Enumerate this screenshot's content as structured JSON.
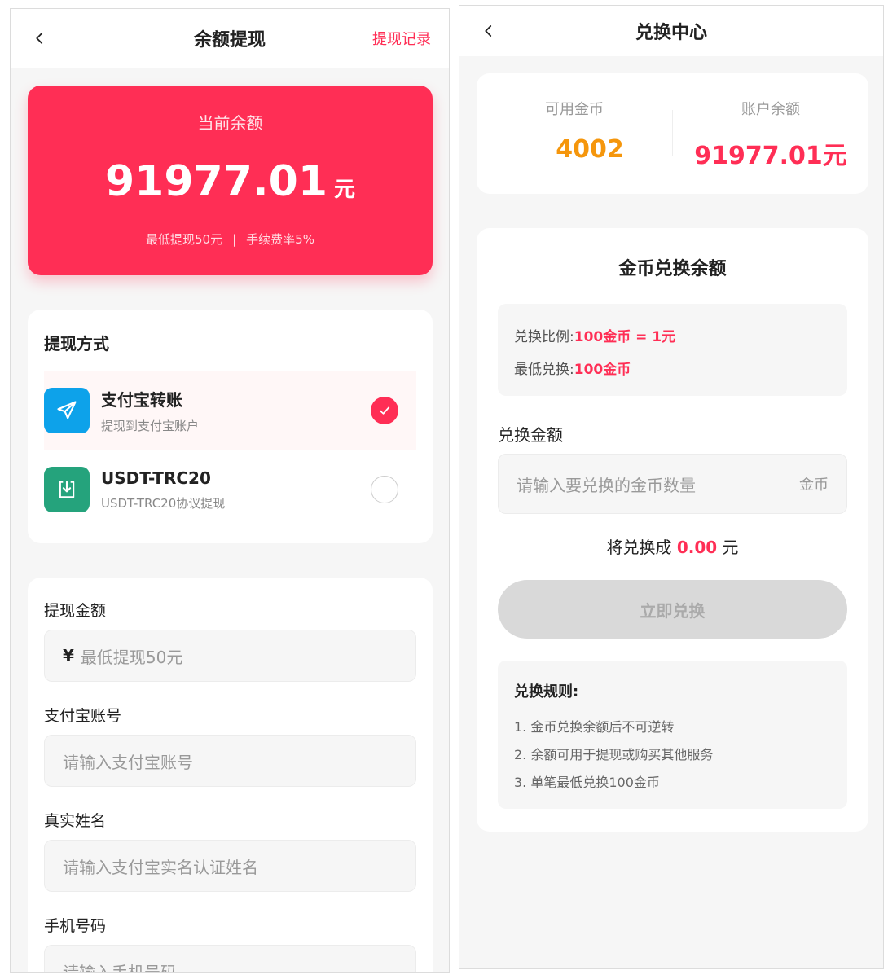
{
  "left": {
    "header": {
      "title": "余额提现",
      "link": "提现记录"
    },
    "balance": {
      "label": "当前余额",
      "amount": "91977.01",
      "unit": "元",
      "min_note": "最低提现50元",
      "divider": "|",
      "fee_note": "手续费率5%"
    },
    "methods": {
      "title": "提现方式",
      "items": [
        {
          "name": "支付宝转账",
          "desc": "提现到支付宝账户",
          "icon": "send-icon",
          "color": "#0da2ea",
          "selected": true
        },
        {
          "name": "USDT-TRC20",
          "desc": "USDT-TRC20协议提现",
          "icon": "download-icon",
          "color": "#25a37c",
          "selected": false
        }
      ]
    },
    "form": {
      "amount_label": "提现金额",
      "amount_prefix": "¥",
      "amount_placeholder": "最低提现50元",
      "account_label": "支付宝账号",
      "account_placeholder": "请输入支付宝账号",
      "name_label": "真实姓名",
      "name_placeholder": "请输入支付宝实名认证姓名",
      "phone_label": "手机号码",
      "phone_placeholder": "请输入手机号码"
    }
  },
  "right": {
    "header": {
      "title": "兑换中心"
    },
    "summary": {
      "coins_label": "可用金币",
      "coins_value": "4002",
      "coins_color": "#f5960c",
      "balance_label": "账户余额",
      "balance_value": "91977.01元",
      "balance_color": "#ff2e55"
    },
    "exchange": {
      "title": "金币兑换余额",
      "rate_label": "兑换比例:",
      "rate_value": "100金币 = 1元",
      "min_label": "最低兑换:",
      "min_value": "100金币",
      "amount_label": "兑换金额",
      "amount_placeholder": "请输入要兑换的金币数量",
      "amount_unit": "金币",
      "will_prefix": "将兑换成",
      "will_value": "0.00",
      "will_suffix": "元",
      "button": "立即兑换",
      "rules_title": "兑换规则:",
      "rules": [
        "1. 金币兑换余额后不可逆转",
        "2. 余额可用于提现或购买其他服务",
        "3. 单笔最低兑换100金币"
      ]
    }
  },
  "colors": {
    "accent": "#ff2e55"
  }
}
